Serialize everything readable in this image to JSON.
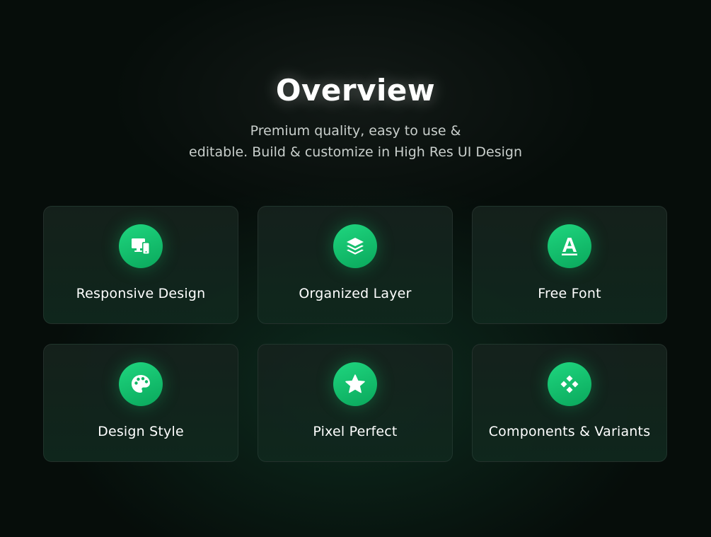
{
  "header": {
    "title": "Overview",
    "subtitle_line1": "Premium quality, easy to use &",
    "subtitle_line2": "editable. Build & customize in High Res UI Design"
  },
  "features": [
    {
      "label": "Responsive Design",
      "icon": "devices-icon"
    },
    {
      "label": "Organized Layer",
      "icon": "layers-icon"
    },
    {
      "label": "Free Font",
      "icon": "font-letter-icon"
    },
    {
      "label": "Design Style",
      "icon": "palette-icon"
    },
    {
      "label": "Pixel Perfect",
      "icon": "star-icon"
    },
    {
      "label": "Components & Variants",
      "icon": "components-icon"
    }
  ],
  "colors": {
    "background": "#060d0a",
    "accent": "#12c46c",
    "card": "#14241d",
    "text": "#ffffff",
    "muted_text": "#c9cfcc"
  }
}
